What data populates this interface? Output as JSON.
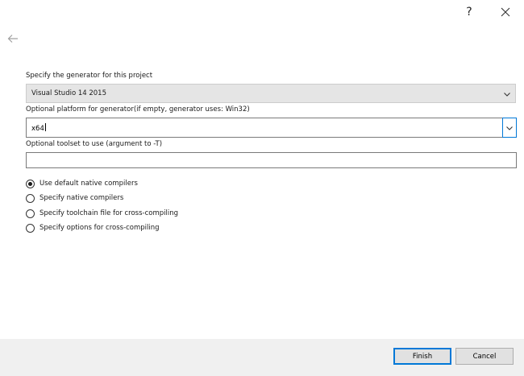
{
  "titlebar": {
    "help_label": "?"
  },
  "form": {
    "generator_label": "Specify the generator for this project",
    "generator_value": "Visual Studio 14 2015",
    "platform_label": "Optional platform for generator(if empty, generator uses: Win32)",
    "platform_value": "x64",
    "toolset_label": "Optional toolset to use (argument to -T)",
    "toolset_value": ""
  },
  "options": [
    {
      "label": "Use default native compilers",
      "checked": true
    },
    {
      "label": "Specify native compilers",
      "checked": false
    },
    {
      "label": "Specify toolchain file for cross-compiling",
      "checked": false
    },
    {
      "label": "Specify options for cross-compiling",
      "checked": false
    }
  ],
  "footer": {
    "finish_label": "Finish",
    "cancel_label": "Cancel"
  },
  "icons": {
    "help": "question-mark",
    "close": "close-x",
    "back": "back-arrow",
    "dropdown": "chevron-down"
  },
  "colors": {
    "accent": "#0078d7",
    "footer_bg": "#f0f0f0",
    "disabled_combo_bg": "#e5e5e5"
  }
}
